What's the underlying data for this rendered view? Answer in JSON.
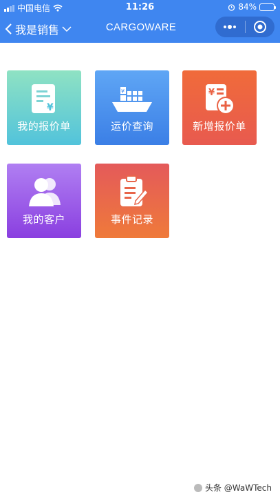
{
  "status_bar": {
    "carrier": "中国电信",
    "time": "11:26",
    "battery": "84%",
    "battery_level": 0.84
  },
  "nav": {
    "back_label": "我是销售",
    "title": "CARGOWARE",
    "more_icon": "more-dots-icon",
    "close_icon": "target-circle-icon"
  },
  "tiles": [
    {
      "label": "我的报价单",
      "icon": "quote-document-icon"
    },
    {
      "label": "运价查询",
      "icon": "cargo-ship-icon"
    },
    {
      "label": "新增报价单",
      "icon": "add-quote-icon"
    },
    {
      "label": "我的客户",
      "icon": "customers-icon"
    },
    {
      "label": "事件记录",
      "icon": "clipboard-edit-icon"
    }
  ],
  "colors": {
    "header": "#3f86f0",
    "tile_1": "#52c3db",
    "tile_2": "#3b7fe6",
    "tile_3": "#e85a4f",
    "tile_4": "#8a3fe0",
    "tile_5": "#ef7a3a"
  },
  "watermark": "头条 @WaWTech"
}
